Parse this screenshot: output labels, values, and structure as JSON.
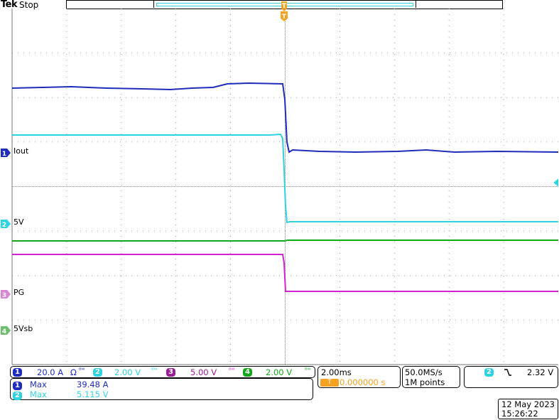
{
  "header": {
    "brand": "Tek",
    "status": "Stop"
  },
  "channels": {
    "ch1": {
      "num": "1",
      "label": "Iout",
      "scale": "20.0 A",
      "color": "#1f2dbd"
    },
    "ch2": {
      "num": "2",
      "label": "5V",
      "scale": "2.00 V",
      "color": "#2fd2e0"
    },
    "ch3": {
      "num": "3",
      "label": "PG",
      "scale": "5.00 V",
      "color": "#d61fd3"
    },
    "ch4": {
      "num": "4",
      "label": "5Vsb",
      "scale": "2.00 V",
      "color": "#13a81a"
    }
  },
  "ch1_suffix": "Ω",
  "bw_symbol": "ᴮᵂ",
  "trigger": {
    "marker": "T",
    "color": "#f5a223"
  },
  "measurements": [
    {
      "num": "1",
      "name": "Max",
      "value": "39.48 A"
    },
    {
      "num": "2",
      "name": "Max",
      "value": "5.115 V"
    }
  ],
  "timebase": {
    "scale": "2.00ms",
    "position": "0.000000 s"
  },
  "acquisition": {
    "rate": "50.0MS/s",
    "points": "1M points"
  },
  "trigger_readout": {
    "source": "2",
    "slope_icon": "falling-edge",
    "level": "2.32 V"
  },
  "datetime": {
    "date": "12 May 2023",
    "time": "15:26:22"
  }
}
